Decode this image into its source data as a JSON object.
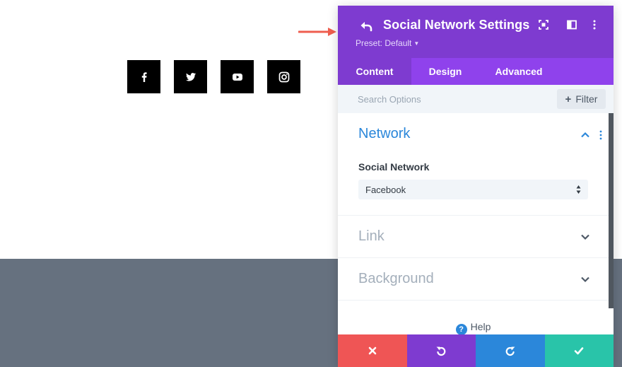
{
  "social_buttons": [
    {
      "icon": "facebook-icon"
    },
    {
      "icon": "twitter-icon"
    },
    {
      "icon": "youtube-icon"
    },
    {
      "icon": "instagram-icon"
    }
  ],
  "panel": {
    "title": "Social Network Settings",
    "preset_label": "Preset: Default",
    "tabs": [
      "Content",
      "Design",
      "Advanced"
    ],
    "active_tab": "Content",
    "search_placeholder": "Search Options",
    "filter_label": "Filter",
    "sections": {
      "network": {
        "title": "Network",
        "field_label": "Social Network",
        "field_value": "Facebook"
      },
      "link": {
        "title": "Link"
      },
      "background": {
        "title": "Background"
      }
    },
    "help_label": "Help",
    "help_icon_glyph": "?"
  },
  "colors": {
    "header_purple": "#7e3bd0",
    "tabs_purple": "#8f42ec",
    "accent_blue": "#2b87da",
    "arrow_red": "#ef5e4f",
    "footer_discard": "#ef5555",
    "footer_undo": "#7e3bd0",
    "footer_redo": "#2b87da",
    "footer_save": "#29c4a9",
    "page_lower_bg": "#66717f"
  }
}
